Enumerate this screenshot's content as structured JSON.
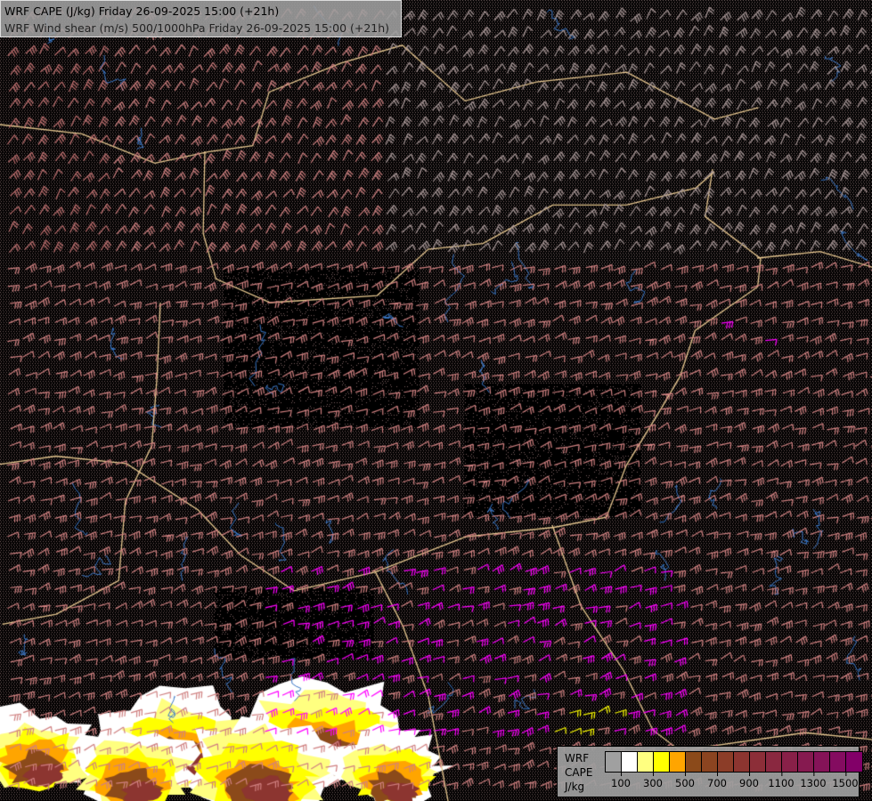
{
  "title": {
    "line1": "WRF CAPE (J/kg) Friday 26-09-2025 15:00 (+21h)",
    "line2": "WRF Wind shear (m/s) 500/1000hPa Friday 26-09-2025 15:00 (+21h)"
  },
  "legend": {
    "label1": "WRF",
    "label2": "CAPE",
    "unit": "J/kg",
    "colors": [
      "#a0a0a0",
      "#ffffff",
      "#ffff80",
      "#ffff00",
      "#ffa500",
      "#8b4a1a",
      "#8b4420",
      "#8c3d28",
      "#8c3530",
      "#8c2e38",
      "#8a2840",
      "#882048",
      "#861a50",
      "#851358",
      "#840c60",
      "#820068"
    ],
    "ticks": [
      "100",
      "300",
      "500",
      "700",
      "900",
      "1100",
      "1300",
      "1500"
    ]
  },
  "colors": {
    "background": "#000000",
    "border": "#e8c890",
    "river": "#3a78c8",
    "barb_low": "#a89898",
    "barb_mid": "#d08080",
    "barb_high": "#ff00ff",
    "barb_extreme": "#ffff00"
  }
}
